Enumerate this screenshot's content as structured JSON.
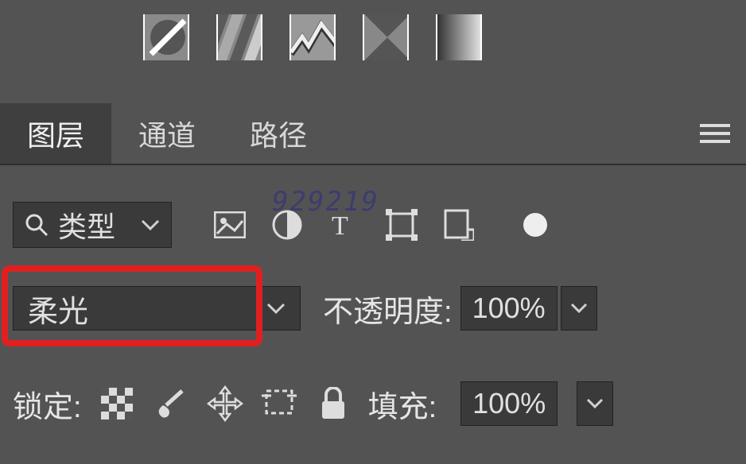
{
  "presets": [
    "preset-solid",
    "preset-gradient",
    "preset-pattern",
    "preset-tri",
    "preset-grad2"
  ],
  "tabs": {
    "layers": "图层",
    "channels": "通道",
    "paths": "路径"
  },
  "watermark": "929219",
  "filter": {
    "search_label": "类型"
  },
  "blend": {
    "mode": "柔光",
    "opacity_label": "不透明度:",
    "opacity_value": "100%"
  },
  "lock": {
    "label": "锁定:",
    "fill_label": "填充:",
    "fill_value": "100%"
  }
}
